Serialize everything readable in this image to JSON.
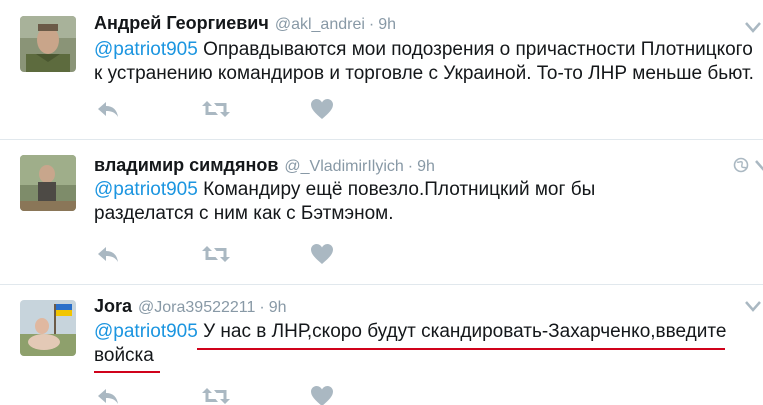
{
  "tweets": [
    {
      "name": "Андрей Георгиевич",
      "handle": "@akl_andrei",
      "separator": "·",
      "time": "9h",
      "mention": "@patriot905",
      "text": " Оправдываются мои подозрения о причастности Плотницкого к устранению командиров и торговле с Украиной. То-то ЛНР меньше бьют."
    },
    {
      "name": "владимир симдянов",
      "handle": "@_VladimirIlyich",
      "separator": "·",
      "time": "9h",
      "mention": "@patriot905",
      "text": " Командиру ещё повезло.Плотницкий мог бы разделатся с ним как с Бэтмэном."
    },
    {
      "name": "Jora",
      "handle": "@Jora39522211",
      "separator": "·",
      "time": "9h",
      "mention": "@patriot905",
      "text": " У нас в ЛНР,скоро будут скандировать-Захарченко,введите войска"
    }
  ],
  "colors": {
    "link": "#1b95e0",
    "icon": "#aab8c2",
    "underline": "#d0021b",
    "divider": "#e1e8ed"
  },
  "icons": [
    "reply-icon",
    "retweet-icon",
    "like-icon",
    "globe-icon",
    "chevron-down-icon"
  ]
}
